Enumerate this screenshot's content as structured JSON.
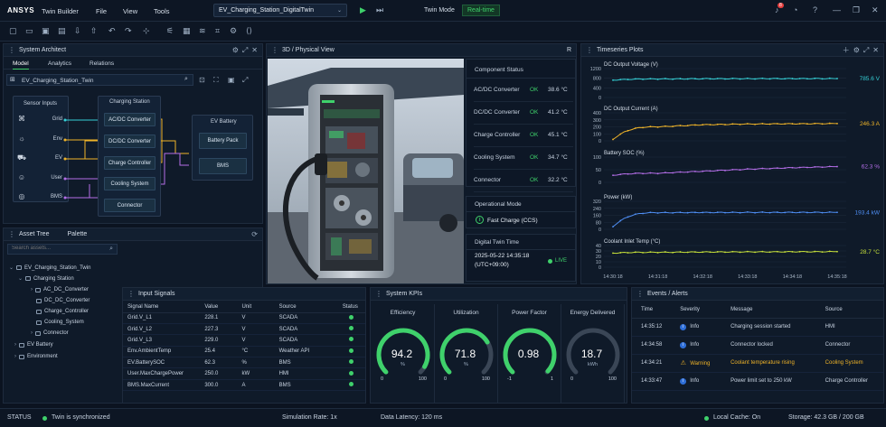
{
  "app": {
    "brand": "ANSYS",
    "product": "Twin Builder",
    "menus": [
      "File",
      "View",
      "Tools"
    ],
    "project": "EV_Charging_Station_DigitalTwin",
    "twin_mode_label": "Twin Mode",
    "twin_mode_value": "Real-time",
    "notif_count": "8"
  },
  "arch": {
    "title": "System Architect",
    "tabs": [
      "Model",
      "Analytics",
      "Relations"
    ],
    "model_name": "EV_Charging_Station_Twin",
    "sensor_title": "Sensor Inputs",
    "sensors": [
      "Grid",
      "Env",
      "EV",
      "User",
      "BMS"
    ],
    "station_title": "Charging Station",
    "station_blocks": [
      "AC/DC Converter",
      "DC/DC Converter",
      "Charge Controller",
      "Cooling System",
      "Connector"
    ],
    "battery_title": "EV Battery",
    "battery_blocks": [
      "Battery Pack",
      "BMS"
    ]
  },
  "tree": {
    "title": "Asset Tree",
    "palette": "Palette",
    "search_placeholder": "Search assets...",
    "items": [
      "EV_Charging_Station_Twin",
      "Charging Station",
      "AC_DC_Converter",
      "DC_DC_Converter",
      "Charge_Controller",
      "Cooling_System",
      "Connector",
      "EV Battery",
      "Environment"
    ]
  },
  "view3d": {
    "title": "3D / Physical View",
    "r_label": "R"
  },
  "comp_status": {
    "title": "Component Status",
    "rows": [
      {
        "name": "AC/DC Converter",
        "status": "OK",
        "temp": "38.6 °C"
      },
      {
        "name": "DC/DC Converter",
        "status": "OK",
        "temp": "41.2 °C"
      },
      {
        "name": "Charge Controller",
        "status": "OK",
        "temp": "45.1 °C"
      },
      {
        "name": "Cooling System",
        "status": "OK",
        "temp": "34.7 °C"
      },
      {
        "name": "Connector",
        "status": "OK",
        "temp": "32.2 °C"
      }
    ]
  },
  "op_mode": {
    "title": "Operational Mode",
    "value": "Fast Charge (CCS)"
  },
  "twin_time": {
    "title": "Digital Twin Time",
    "date": "2025-05-22 14:35:18",
    "tz": "(UTC+09:00)",
    "live": "LIVE"
  },
  "timeseries": {
    "title": "Timeseries Plots",
    "x_ticks": [
      "14:30:18",
      "14:31:18",
      "14:32:18",
      "14:33:18",
      "14:34:18",
      "14:35:18"
    ]
  },
  "chart_data": [
    {
      "type": "line",
      "title": "DC Output Voltage (V)",
      "x": [
        "14:30:18",
        "14:31:18",
        "14:32:18",
        "14:33:18",
        "14:34:18",
        "14:35:18"
      ],
      "yticks": [
        "1200",
        "800",
        "400",
        "0"
      ],
      "ylim": [
        0,
        1200
      ],
      "values": [
        720,
        770,
        778,
        782,
        784,
        785.6
      ],
      "value_label": "785.6 V",
      "color": "#35d0d6"
    },
    {
      "type": "line",
      "title": "DC Output Current (A)",
      "x": [
        "14:30:18",
        "14:31:18",
        "14:32:18",
        "14:33:18",
        "14:34:18",
        "14:35:18"
      ],
      "yticks": [
        "400",
        "300",
        "200",
        "100",
        "0"
      ],
      "ylim": [
        0,
        400
      ],
      "values": [
        20,
        200,
        230,
        240,
        244,
        246.3
      ],
      "value_label": "246.3 A",
      "color": "#f0b429"
    },
    {
      "type": "line",
      "title": "Battery SOC (%)",
      "x": [
        "14:30:18",
        "14:31:18",
        "14:32:18",
        "14:33:18",
        "14:34:18",
        "14:35:18"
      ],
      "yticks": [
        "100",
        "50",
        "0"
      ],
      "ylim": [
        0,
        100
      ],
      "values": [
        28,
        36,
        44,
        52,
        58,
        62.3
      ],
      "value_label": "62.3 %",
      "color": "#b46ee8"
    },
    {
      "type": "line",
      "title": "Power (kW)",
      "x": [
        "14:30:18",
        "14:31:18",
        "14:32:18",
        "14:33:18",
        "14:34:18",
        "14:35:18"
      ],
      "yticks": [
        "320",
        "240",
        "160",
        "80",
        "0"
      ],
      "ylim": [
        0,
        320
      ],
      "values": [
        30,
        190,
        192,
        193,
        193,
        193.4
      ],
      "value_label": "193.4 kW",
      "color": "#4f8ff5"
    },
    {
      "type": "line",
      "title": "Coolant Inlet Temp (°C)",
      "x": [
        "14:30:18",
        "14:31:18",
        "14:32:18",
        "14:33:18",
        "14:34:18",
        "14:35:18"
      ],
      "yticks": [
        "40",
        "30",
        "20",
        "10",
        "0"
      ],
      "ylim": [
        0,
        40
      ],
      "values": [
        26,
        27.5,
        28,
        28.3,
        28.5,
        28.7
      ],
      "value_label": "28.7 °C",
      "color": "#c6e03a"
    }
  ],
  "signals": {
    "title": "Input Signals",
    "headers": [
      "Signal Name",
      "Value",
      "Unit",
      "Source",
      "Status"
    ],
    "rows": [
      [
        "Grid.V_L1",
        "228.1",
        "V",
        "SCADA"
      ],
      [
        "Grid.V_L2",
        "227.3",
        "V",
        "SCADA"
      ],
      [
        "Grid.V_L3",
        "229.0",
        "V",
        "SCADA"
      ],
      [
        "Env.AmbientTemp",
        "25.4",
        "°C",
        "Weather API"
      ],
      [
        "EV.BatterySOC",
        "62.3",
        "%",
        "BMS"
      ],
      [
        "User.MaxChargePower",
        "250.0",
        "kW",
        "HMI"
      ],
      [
        "BMS.MaxCurrent",
        "300.0",
        "A",
        "BMS"
      ]
    ]
  },
  "kpis": {
    "title": "System KPIs",
    "items": [
      {
        "name": "Efficiency",
        "value": "94.2",
        "unit": "%",
        "min": "0",
        "max": "100",
        "fill": 0.942,
        "color": "#3fd16b"
      },
      {
        "name": "Utilization",
        "value": "71.8",
        "unit": "%",
        "min": "0",
        "max": "100",
        "fill": 0.718,
        "color": "#3fd16b"
      },
      {
        "name": "Power Factor",
        "value": "0.98",
        "unit": "",
        "min": "-1",
        "max": "1",
        "fill": 0.99,
        "color": "#3fd16b"
      },
      {
        "name": "Energy Delivered",
        "value": "18.7",
        "unit": "kWh",
        "min": "0",
        "max": "100",
        "fill": 0.0,
        "color": "#6b7a8c"
      }
    ]
  },
  "events": {
    "title": "Events / Alerts",
    "headers": [
      "Time",
      "Severity",
      "Message",
      "Source"
    ],
    "rows": [
      {
        "time": "14:35:12",
        "sev": "Info",
        "msg": "Charging session started",
        "src": "HMI",
        "warn": false
      },
      {
        "time": "14:34:58",
        "sev": "Info",
        "msg": "Connector locked",
        "src": "Connector",
        "warn": false
      },
      {
        "time": "14:34:21",
        "sev": "Warning",
        "msg": "Coolant temperature rising",
        "src": "Cooling System",
        "warn": true
      },
      {
        "time": "14:33:47",
        "sev": "Info",
        "msg": "Power limit set to 250 kW",
        "src": "Charge Controller",
        "warn": false
      }
    ]
  },
  "status": {
    "label": "STATUS",
    "sync": "Twin is synchronized",
    "sim": "Simulation Rate:  1x",
    "lat": "Data Latency:  120 ms",
    "cache": "Local Cache:  On",
    "storage": "Storage:  42.3 GB  /  200 GB"
  }
}
